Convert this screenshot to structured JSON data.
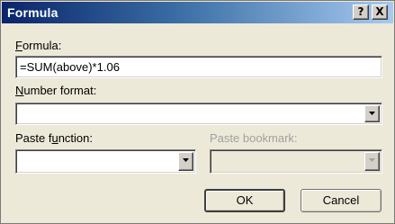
{
  "window": {
    "title": "Formula",
    "help_label": "?",
    "close_label": "X"
  },
  "formula": {
    "label_prefix": "",
    "label_mnemonic": "F",
    "label_rest": "ormula:",
    "value": "=SUM(above)*1.06"
  },
  "number_format": {
    "label_mnemonic": "N",
    "label_rest": "umber format:",
    "value": ""
  },
  "paste_function": {
    "label_prefix": "Paste f",
    "label_mnemonic": "u",
    "label_rest": "nction:",
    "value": ""
  },
  "paste_bookmark": {
    "label": "Paste bookmark:",
    "value": "",
    "enabled": false
  },
  "buttons": {
    "ok_label": "OK",
    "cancel_label": "Cancel"
  },
  "colors": {
    "title_bar_start": "#0a246a",
    "title_bar_end": "#a6caf0",
    "dialog_bg": "#ece9d8"
  },
  "icons": {
    "dropdown": "chevron-down-icon"
  }
}
